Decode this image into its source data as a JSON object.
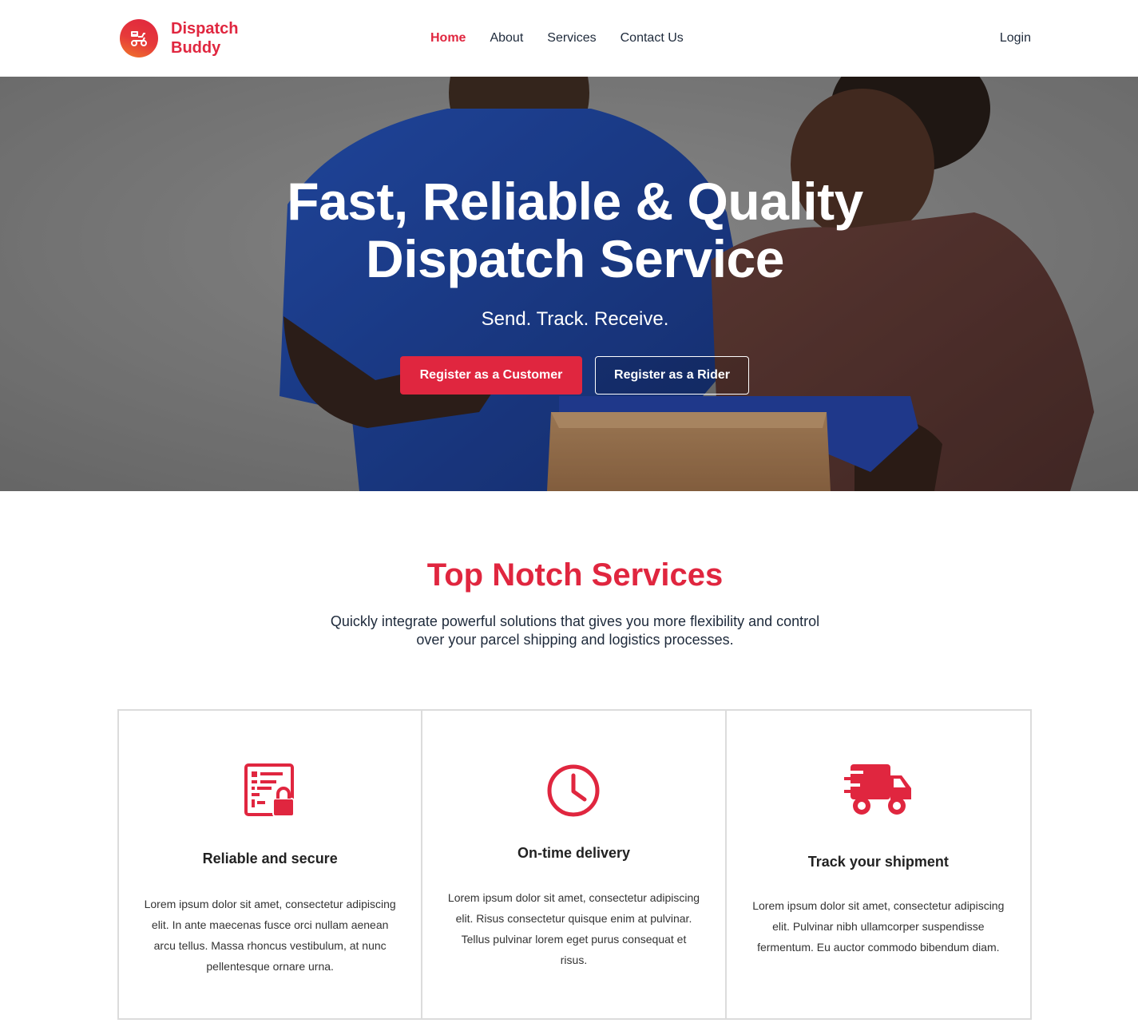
{
  "brand": {
    "name_line1": "Dispatch",
    "name_line2": "Buddy",
    "logo_icon": "scooter-delivery-icon",
    "color": "#e0263f"
  },
  "nav": {
    "items": [
      {
        "label": "Home",
        "active": true
      },
      {
        "label": "About",
        "active": false
      },
      {
        "label": "Services",
        "active": false
      },
      {
        "label": "Contact Us",
        "active": false
      }
    ],
    "login_label": "Login"
  },
  "hero": {
    "title_line1": "Fast, Reliable & Quality",
    "title_line2": "Dispatch Service",
    "subtitle": "Send. Track. Receive.",
    "primary_button": "Register as a Customer",
    "secondary_button": "Register as a Rider"
  },
  "services": {
    "title": "Top Notch Services",
    "description_line1": "Quickly integrate powerful solutions that gives you more flexibility and control",
    "description_line2": "over your parcel shipping and logistics processes.",
    "cards": [
      {
        "icon": "secure-document-lock-icon",
        "title": "Reliable and secure",
        "text": "Lorem ipsum dolor sit amet, consectetur adipiscing elit. In ante maecenas fusce orci nullam aenean arcu tellus. Massa rhoncus vestibulum, at nunc pellentesque ornare urna."
      },
      {
        "icon": "clock-icon",
        "title": "On-time delivery",
        "text": "Lorem ipsum dolor sit amet, consectetur adipiscing elit. Risus consectetur quisque enim at pulvinar. Tellus pulvinar lorem eget purus consequat et risus."
      },
      {
        "icon": "fast-truck-icon",
        "title": "Track your shipment",
        "text": "Lorem ipsum dolor sit amet, consectetur adipiscing elit. Pulvinar nibh ullamcorper suspendisse fermentum. Eu auctor commodo bibendum diam."
      }
    ]
  }
}
